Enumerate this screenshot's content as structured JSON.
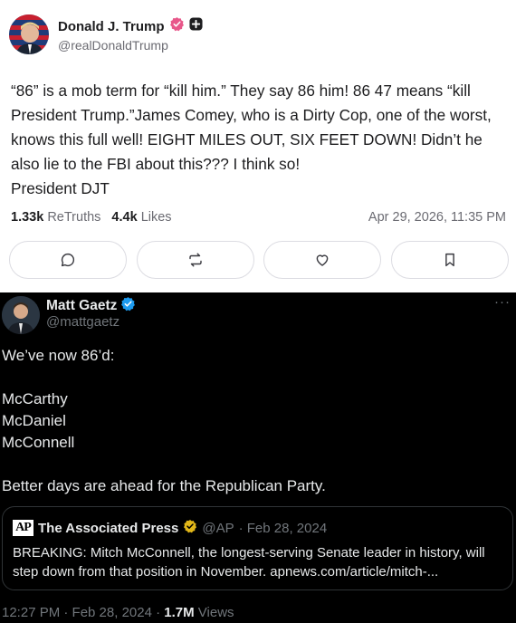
{
  "truth_post": {
    "author_name": "Donald J. Trump",
    "author_handle": "@realDonaldTrump",
    "body": "“86” is a mob term for “kill him.” They say 86 him! 86 47 means “kill President Trump.”James Comey, who is a Dirty Cop, one of the worst, knows this full well! EIGHT MILES OUT, SIX FEET DOWN! Didn’t he also lie to the FBI about this??? I think so!",
    "signature": "President DJT",
    "retruths_count": "1.33k",
    "retruths_label": "ReTruths",
    "likes_count": "4.4k",
    "likes_label": "Likes",
    "timestamp": "Apr 29, 2026, 11:35 PM",
    "actions": [
      "reply-icon",
      "retruth-icon",
      "like-icon",
      "bookmark-icon"
    ],
    "verified_color": "#e8578a"
  },
  "x_post": {
    "author_name": "Matt Gaetz",
    "author_handle": "@mattgaetz",
    "more": "···",
    "lines": [
      "We’ve now 86’d:",
      "",
      "McCarthy",
      "McDaniel",
      "McConnell",
      "",
      "Better days are ahead for the Republican Party."
    ],
    "quote": {
      "logo": "AP",
      "name": "The Associated Press",
      "handle": "@AP",
      "date": "· Feb 28, 2024",
      "text": "BREAKING: Mitch McConnell, the longest-serving Senate leader in history, will step down from that position in November.  apnews.com/article/mitch-..."
    },
    "footer_time": "12:27 PM · Feb 28, 2024 · ",
    "views_count": "1.7M",
    "views_label": " Views",
    "verified_color": "#1d9bf0",
    "gold_verified_color": "#e2b719"
  }
}
